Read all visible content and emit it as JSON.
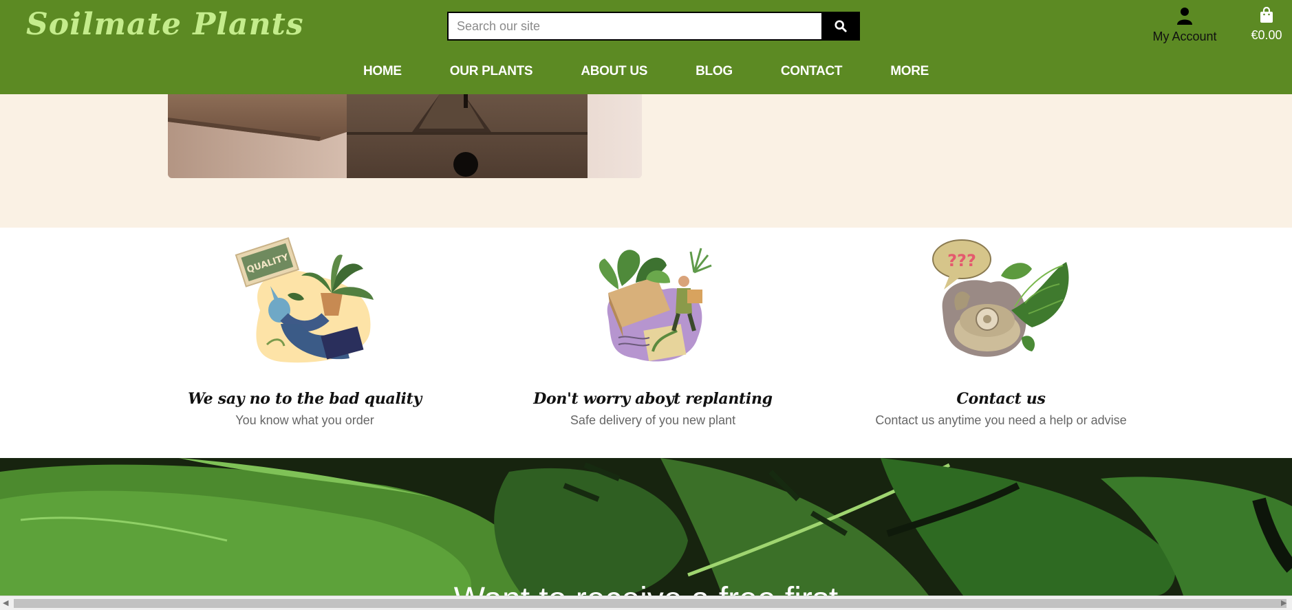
{
  "header": {
    "logo": "Soilmate Plants",
    "search_placeholder": "Search our site",
    "account_label": "My Account",
    "cart_total": "€0.00",
    "nav": [
      "HOME",
      "OUR PLANTS",
      "ABOUT US",
      "BLOG",
      "CONTACT",
      "MORE"
    ]
  },
  "features": [
    {
      "title": "We say no to the bad quality",
      "subtitle": "You know what you order",
      "icon": "quality-illustration",
      "badge": "QUALITY"
    },
    {
      "title": "Don't worry aboyt replanting",
      "subtitle": "Safe delivery of you new plant",
      "icon": "delivery-illustration"
    },
    {
      "title": "Contact us",
      "subtitle": "Contact us anytime you need a help or advise",
      "icon": "phone-illustration",
      "bubble": "???"
    }
  ],
  "banner": {
    "text": "Want to receive a free first"
  },
  "colors": {
    "header_bg": "#5c8a23",
    "logo": "#c4ec8c",
    "cream": "#faf1e4"
  }
}
